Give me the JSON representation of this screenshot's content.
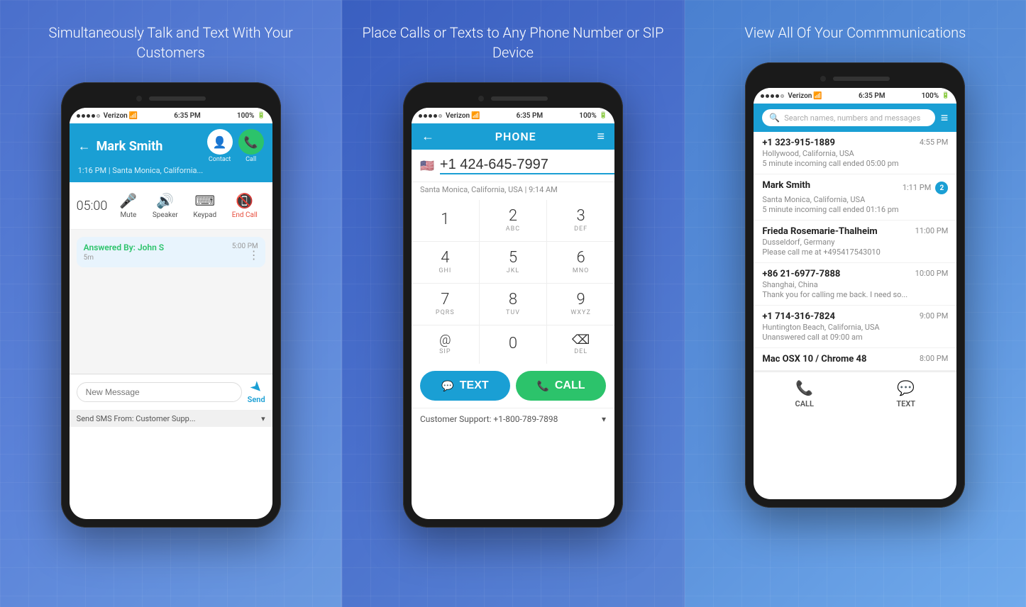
{
  "panel_left": {
    "title": "Simultaneously Talk and Text With\nYour Customers",
    "phone": {
      "status_bar": {
        "dots": [
          "filled",
          "filled",
          "filled",
          "filled",
          "empty"
        ],
        "carrier": "Verizon",
        "time": "6:35 PM",
        "battery": "100%"
      },
      "header": {
        "contact_name": "Mark Smith",
        "subtitle": "1:16 PM | Santa Monica, California...",
        "contact_label": "Contact",
        "call_label": "Call"
      },
      "call_controls": {
        "timer": "05:00",
        "mute": "Mute",
        "speaker": "Speaker",
        "keypad": "Keypad",
        "end_call": "End Call"
      },
      "message": {
        "sender": "Answered By: John S",
        "time": "5:00 PM",
        "duration": "5m"
      },
      "sms_input": {
        "placeholder": "New Message",
        "send_label": "Send",
        "from_label": "Send SMS From: Customer Supp..."
      }
    }
  },
  "panel_center": {
    "title": "Place Calls or Texts to Any\nPhone Number or SIP Device",
    "phone": {
      "status_bar": {
        "dots": [
          "filled",
          "filled",
          "filled",
          "filled",
          "empty"
        ],
        "carrier": "Verizon",
        "time": "6:35 PM",
        "battery": "100%"
      },
      "header": {
        "title": "PHONE"
      },
      "dialer": {
        "flag": "🇺🇸",
        "number": "+1 424-645-7997",
        "location": "Santa Monica, California, USA | 9:14 AM",
        "keys": [
          {
            "num": "1",
            "letters": ""
          },
          {
            "num": "2",
            "letters": "ABC"
          },
          {
            "num": "3",
            "letters": "DEF"
          },
          {
            "num": "4",
            "letters": "GHI"
          },
          {
            "num": "5",
            "letters": "JKL"
          },
          {
            "num": "6",
            "letters": "MNO"
          },
          {
            "num": "7",
            "letters": "PQRS"
          },
          {
            "num": "8",
            "letters": "TUV"
          },
          {
            "num": "9",
            "letters": "WXYZ"
          },
          {
            "num": "@",
            "letters": "SIP"
          },
          {
            "num": "0",
            "letters": ""
          },
          {
            "num": "⌫",
            "letters": "DEL"
          }
        ],
        "text_btn": "TEXT",
        "call_btn": "CALL",
        "support": "Customer Support: +1-800-789-7898"
      }
    }
  },
  "panel_right": {
    "title": "View All Of Your Commmunications",
    "phone": {
      "status_bar": {
        "dots": [
          "filled",
          "filled",
          "filled",
          "filled",
          "empty"
        ],
        "carrier": "Verizon",
        "time": "6:35 PM",
        "battery": "100%"
      },
      "search_placeholder": "Search names, numbers and messages",
      "contacts": [
        {
          "name": "+1 323-915-1889",
          "location": "Hollywood, California, USA",
          "message": "5 minute incoming call ended 05:00 pm",
          "time": "4:55 PM",
          "badge": null
        },
        {
          "name": "Mark Smith",
          "location": "Santa Monica, California, USA",
          "message": "5 minute incoming call ended 01:16 pm",
          "time": "1:11 PM",
          "badge": "2"
        },
        {
          "name": "Frieda Rosemarie-Thalheim",
          "location": "Dusseldorf, Germany",
          "message": "Please call me at +495417543010",
          "time": "11:00 PM",
          "badge": null
        },
        {
          "name": "+86 21-6977-7888",
          "location": "Shanghai, China",
          "message": "Thank you for calling me back. I need so...",
          "time": "10:00 PM",
          "badge": null
        },
        {
          "name": "+1 714-316-7824",
          "location": "Huntington Beach, California, USA",
          "message": "Unanswered call at 09:00 am",
          "time": "9:00 PM",
          "badge": null
        },
        {
          "name": "Mac OSX 10 / Chrome 48",
          "location": "",
          "message": "",
          "time": "8:00 PM",
          "badge": null
        }
      ],
      "bottom_actions": {
        "call_label": "CALL",
        "text_label": "TEXT"
      }
    }
  }
}
